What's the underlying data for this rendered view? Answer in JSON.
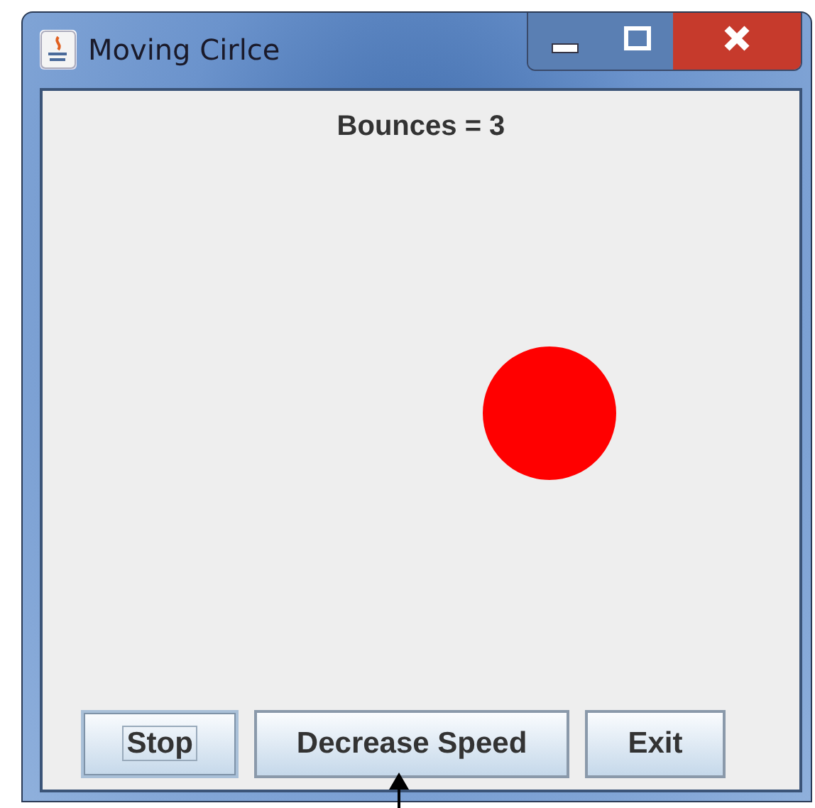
{
  "window": {
    "title": "Moving Cirlce"
  },
  "label": "Bounces = 3",
  "buttons": [
    {
      "label": "Stop",
      "selected": true
    },
    {
      "label": "Decrease Speed",
      "selected": false
    },
    {
      "label": "Exit",
      "selected": false
    }
  ]
}
